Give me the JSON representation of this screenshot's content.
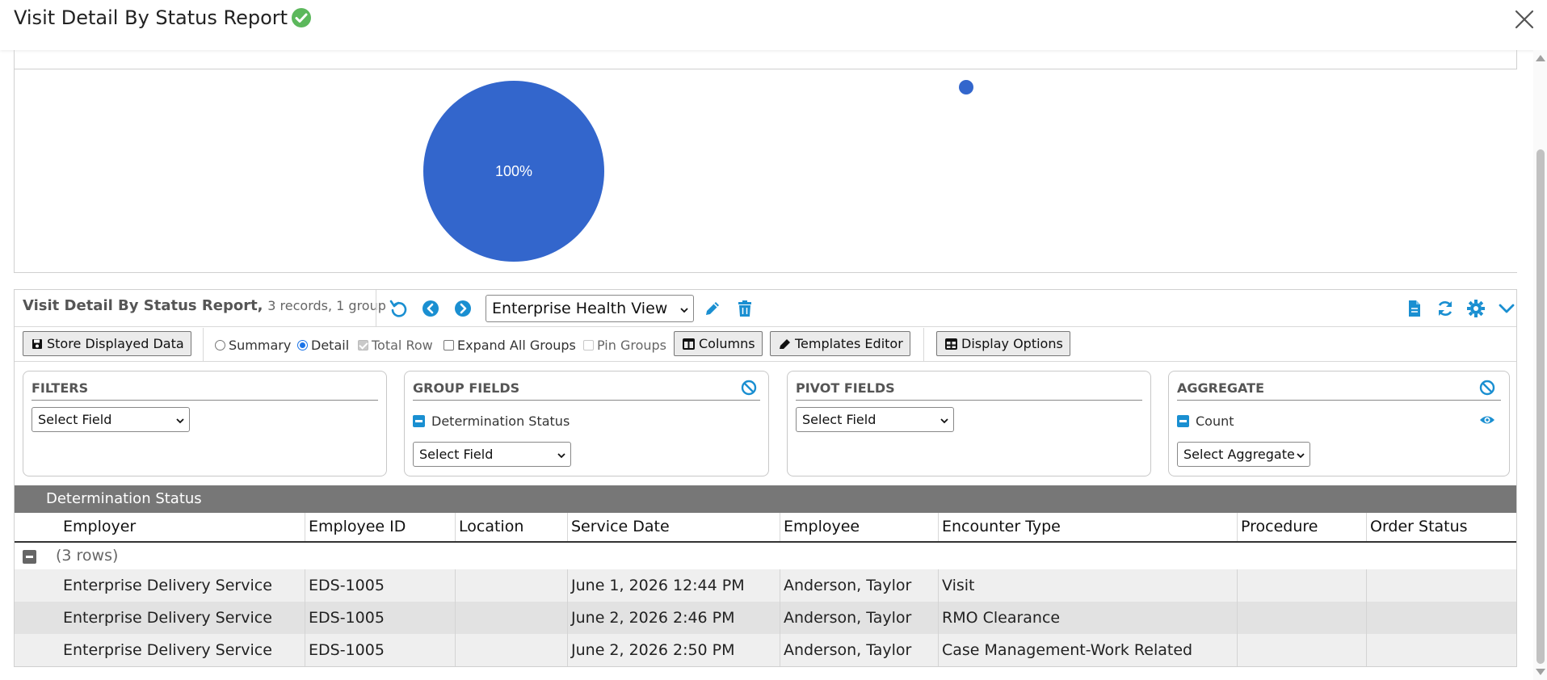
{
  "window": {
    "title": "Visit Detail By Status Report",
    "status_icon": "check-circle-icon",
    "status_color": "#5cb85c"
  },
  "chart": {
    "chart_data": {
      "type": "pie",
      "slices": [
        {
          "label": "100%",
          "value": 100,
          "color": "#3366cc"
        }
      ],
      "legend_marker_color": "#3366cc"
    }
  },
  "toolbar": {
    "report_name": "Visit Detail By Status Report,",
    "record_summary": "3 records, 1 group",
    "view_selected": "Enterprise Health View",
    "accent_color": "#1a8fd1",
    "icons": [
      "undo-icon",
      "previous-icon",
      "next-icon",
      "edit-pencil-icon",
      "trash-icon",
      "document-icon",
      "refresh-icon",
      "gear-icon",
      "chevron-down-icon"
    ]
  },
  "options": {
    "store_button": "Store Displayed Data",
    "summary": "Summary",
    "detail": "Detail",
    "total_row": "Total Row",
    "expand_all": "Expand All Groups",
    "pin_groups": "Pin Groups",
    "columns_button": "Columns",
    "templates_button": "Templates Editor",
    "display_button": "Display Options",
    "mode": "Detail"
  },
  "panels": {
    "filters": {
      "title": "FILTERS",
      "select": "Select Field"
    },
    "group": {
      "title": "GROUP FIELDS",
      "item": "Determination Status",
      "select": "Select Field"
    },
    "pivot": {
      "title": "PIVOT FIELDS",
      "select": "Select Field"
    },
    "aggregate": {
      "title": "AGGREGATE",
      "item": "Count",
      "select": "Select Aggregate"
    }
  },
  "grid": {
    "group_band": "Determination Status",
    "columns": [
      "Employer",
      "Employee ID",
      "Location",
      "Service Date",
      "Employee",
      "Encounter Type",
      "Procedure",
      "Order Status"
    ],
    "group_count": "(3 rows)",
    "rows": [
      [
        "Enterprise Delivery Service",
        "EDS-1005",
        "",
        "June 1, 2026 12:44 PM",
        "Anderson, Taylor",
        "Visit",
        "",
        ""
      ],
      [
        "Enterprise Delivery Service",
        "EDS-1005",
        "",
        "June 2, 2026 2:46 PM",
        "Anderson, Taylor",
        "RMO Clearance",
        "",
        ""
      ],
      [
        "Enterprise Delivery Service",
        "EDS-1005",
        "",
        "June 2, 2026 2:50 PM",
        "Anderson, Taylor",
        "Case Management-Work Related",
        "",
        ""
      ]
    ]
  }
}
